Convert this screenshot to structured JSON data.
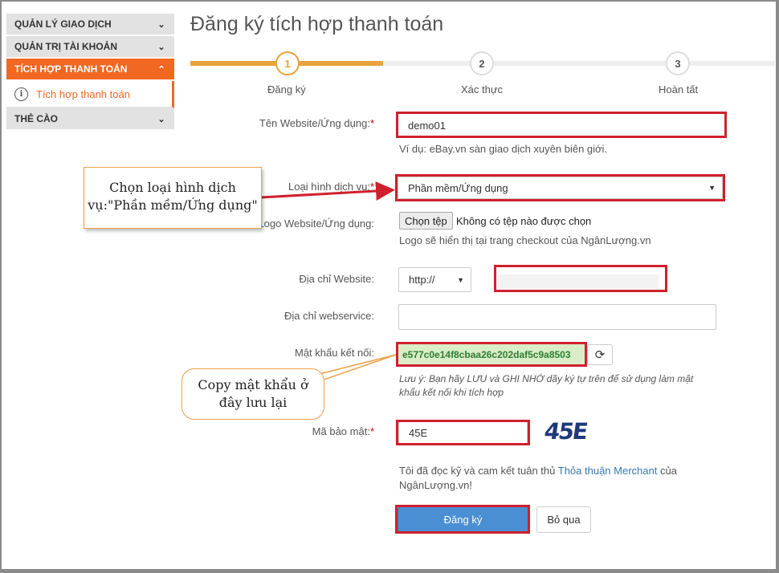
{
  "sidebar": {
    "items": [
      {
        "label": "QUẢN LÝ GIAO DỊCH"
      },
      {
        "label": "QUẢN TRỊ TÀI KHOẢN"
      },
      {
        "label": "TÍCH HỢP THANH TOÁN"
      },
      {
        "label": "THẺ CÀO"
      }
    ],
    "sub_item": {
      "label": "Tích hợp thanh toán"
    }
  },
  "page": {
    "title": "Đăng ký tích hợp thanh toán"
  },
  "steps": [
    {
      "number": "1",
      "label": "Đăng ký"
    },
    {
      "number": "2",
      "label": "Xác thực"
    },
    {
      "number": "3",
      "label": "Hoàn tất"
    }
  ],
  "form": {
    "website_name": {
      "label": "Tên Website/Ứng dụng:",
      "required": "*",
      "value": "demo01",
      "hint": "Ví dụ: eBay.vn sàn giao dịch xuyên biên giới."
    },
    "service_type": {
      "label": "Loại hình dịch vụ:",
      "required": "*",
      "value": "Phần mềm/Ứng dụng"
    },
    "logo": {
      "label": "Logo Website/Ứng dụng:",
      "button": "Chọn tệp",
      "no_file": "Không có tệp nào được chọn",
      "hint": "Logo sẽ hiển thị tại trang checkout của NgânLượng.vn"
    },
    "website_address": {
      "label": "Địa chỉ Website:",
      "protocol": "http://",
      "value": ""
    },
    "webservice": {
      "label": "Địa chỉ webservice:",
      "value": ""
    },
    "password": {
      "label": "Mật khẩu kết nối:",
      "value": "e577c0e14f8cbaa26c202daf5c9a8503",
      "note": "Lưu ý: Bạn hãy LƯU và GHI NHỚ dãy ký tự trên để sử dụng làm mật khẩu kết nối khi tích hợp"
    },
    "captcha": {
      "label": "Mã bảo mật:",
      "required": "*",
      "value": "45E",
      "image_text": "45E"
    },
    "agreement": {
      "text_before": "Tôi đã đọc kỹ và cam kết tuân thủ ",
      "link": "Thỏa thuận Merchant",
      "text_after": " của",
      "line2": "NgânLượng.vn!"
    },
    "submit": "Đăng ký",
    "cancel": "Bỏ qua"
  },
  "callouts": {
    "service": {
      "line1": "Chọn loại hình dịch",
      "line2": "vụ:\"Phần mềm/Ứng dụng\""
    },
    "password": {
      "line1": "Copy mật khẩu ở",
      "line2": "đây lưu lại"
    }
  },
  "colors": {
    "accent": "#f26722",
    "step_active": "#e9a33a",
    "highlight": "#d0202e",
    "primary_button": "#4a8fd4",
    "callout_border": "#f0a04a"
  }
}
